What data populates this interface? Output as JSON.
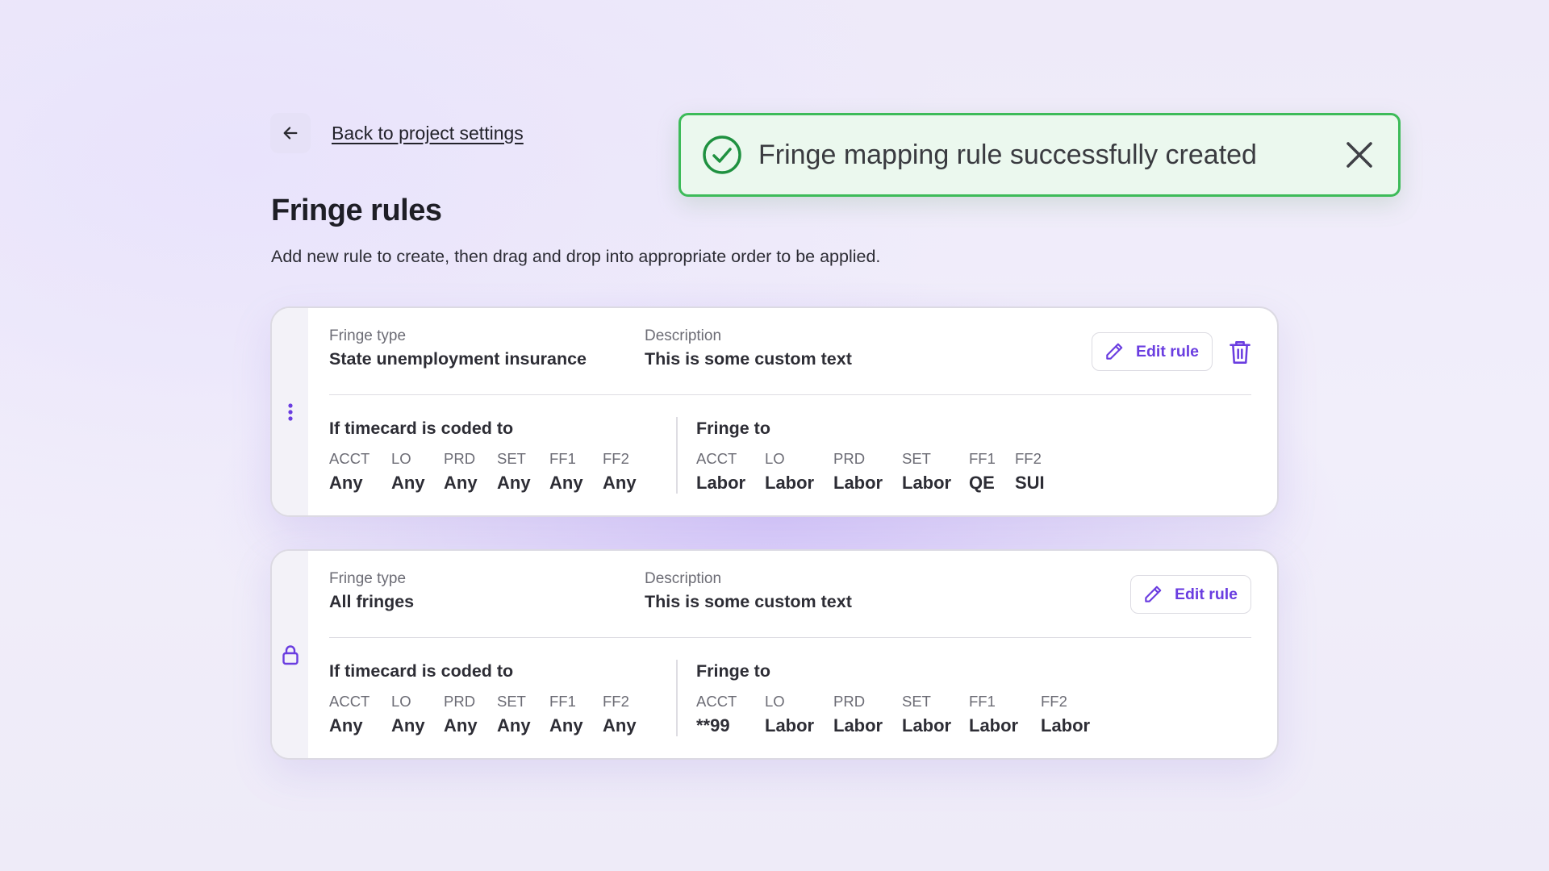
{
  "back": {
    "label": "Back to project settings"
  },
  "toast": {
    "message": "Fringe mapping rule successfully created",
    "color": "#3dbb59"
  },
  "page": {
    "title": "Fringe rules",
    "subtitle": "Add new rule to create, then drag and drop into appropriate order to be applied."
  },
  "accent_color": "#6a3de0",
  "rules": [
    {
      "handle_icon": "drag-handle-icon",
      "fringe_type_label": "Fringe type",
      "fringe_type": "State unemployment insurance",
      "description_label": "Description",
      "description": "This is some custom text",
      "edit_label": "Edit rule",
      "coded_title": "If timecard is coded to",
      "fringe_title": "Fringe to",
      "coded": [
        {
          "k": "ACCT",
          "v": "Any"
        },
        {
          "k": "LO",
          "v": "Any"
        },
        {
          "k": "PRD",
          "v": "Any"
        },
        {
          "k": "SET",
          "v": "Any"
        },
        {
          "k": "FF1",
          "v": "Any"
        },
        {
          "k": "FF2",
          "v": "Any"
        }
      ],
      "fringe": [
        {
          "k": "ACCT",
          "v": "Labor"
        },
        {
          "k": "LO",
          "v": "Labor"
        },
        {
          "k": "PRD",
          "v": "Labor"
        },
        {
          "k": "SET",
          "v": "Labor"
        },
        {
          "k": "FF1",
          "v": "QE"
        },
        {
          "k": "FF2",
          "v": "SUI"
        }
      ]
    },
    {
      "handle_icon": "lock-icon",
      "fringe_type_label": "Fringe type",
      "fringe_type": "All fringes",
      "description_label": "Description",
      "description": "This is some custom text",
      "edit_label": "Edit rule",
      "coded_title": "If timecard is coded to",
      "fringe_title": "Fringe to",
      "coded": [
        {
          "k": "ACCT",
          "v": "Any"
        },
        {
          "k": "LO",
          "v": "Any"
        },
        {
          "k": "PRD",
          "v": "Any"
        },
        {
          "k": "SET",
          "v": "Any"
        },
        {
          "k": "FF1",
          "v": "Any"
        },
        {
          "k": "FF2",
          "v": "Any"
        }
      ],
      "fringe": [
        {
          "k": "ACCT",
          "v": "**99"
        },
        {
          "k": "LO",
          "v": "Labor"
        },
        {
          "k": "PRD",
          "v": "Labor"
        },
        {
          "k": "SET",
          "v": "Labor"
        },
        {
          "k": "FF1",
          "v": "Labor"
        },
        {
          "k": "FF2",
          "v": "Labor"
        }
      ]
    }
  ]
}
